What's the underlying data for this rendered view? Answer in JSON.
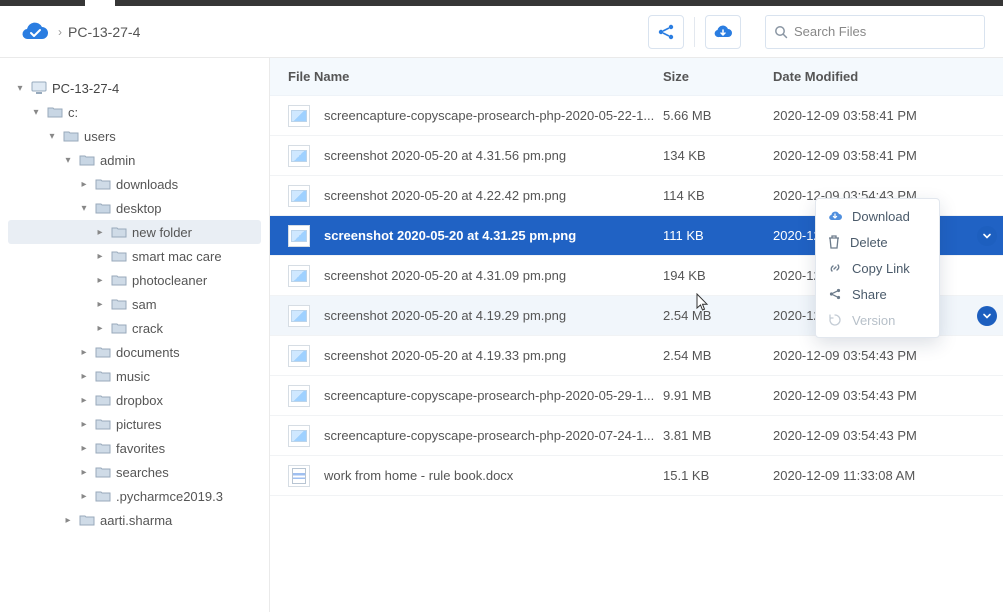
{
  "breadcrumb": {
    "root": "PC-13-27-4"
  },
  "search": {
    "placeholder": "Search Files"
  },
  "tree": {
    "pc": "PC-13-27-4",
    "c": "c:",
    "users": "users",
    "admin": "admin",
    "downloads": "downloads",
    "desktop": "desktop",
    "newfolder": "new folder",
    "smartmaccare": "smart mac care",
    "photocleaner": "photocleaner",
    "sam": "sam",
    "crack": "crack",
    "documents": "documents",
    "music": "music",
    "dropbox": "dropbox",
    "pictures": "pictures",
    "favorites": "favorites",
    "searches": "searches",
    "pycharm": ".pycharmce2019.3",
    "aarti": "aarti.sharma"
  },
  "columns": {
    "name": "File Name",
    "size": "Size",
    "date": "Date Modified"
  },
  "files": [
    {
      "name": "screencapture-copyscape-prosearch-php-2020-05-22-1...",
      "size": "5.66 MB",
      "date": "2020-12-09 03:58:41 PM",
      "kind": "img"
    },
    {
      "name": "screenshot 2020-05-20 at 4.31.56 pm.png",
      "size": "134 KB",
      "date": "2020-12-09 03:58:41 PM",
      "kind": "img"
    },
    {
      "name": "screenshot 2020-05-20 at 4.22.42 pm.png",
      "size": "114 KB",
      "date": "2020-12-09 03:54:43 PM",
      "kind": "img"
    },
    {
      "name": "screenshot 2020-05-20 at 4.31.25 pm.png",
      "size": "111 KB",
      "date": "2020-12-09 03:54:43 PM",
      "kind": "img"
    },
    {
      "name": "screenshot 2020-05-20 at 4.31.09 pm.png",
      "size": "194 KB",
      "date": "2020-12-09 03:54:43 PM",
      "kind": "img"
    },
    {
      "name": "screenshot 2020-05-20 at 4.19.29 pm.png",
      "size": "2.54 MB",
      "date": "2020-12-09 03:54:43 PM",
      "kind": "img"
    },
    {
      "name": "screenshot 2020-05-20 at 4.19.33 pm.png",
      "size": "2.54 MB",
      "date": "2020-12-09 03:54:43 PM",
      "kind": "img"
    },
    {
      "name": "screencapture-copyscape-prosearch-php-2020-05-29-1...",
      "size": "9.91 MB",
      "date": "2020-12-09 03:54:43 PM",
      "kind": "img"
    },
    {
      "name": "screencapture-copyscape-prosearch-php-2020-07-24-1...",
      "size": "3.81 MB",
      "date": "2020-12-09 03:54:43 PM",
      "kind": "img"
    },
    {
      "name": "work from home - rule book.docx",
      "size": "15.1 KB",
      "date": "2020-12-09 11:33:08 AM",
      "kind": "doc"
    }
  ],
  "menu": {
    "download": "Download",
    "delete": "Delete",
    "copylink": "Copy Link",
    "share": "Share",
    "version": "Version"
  }
}
